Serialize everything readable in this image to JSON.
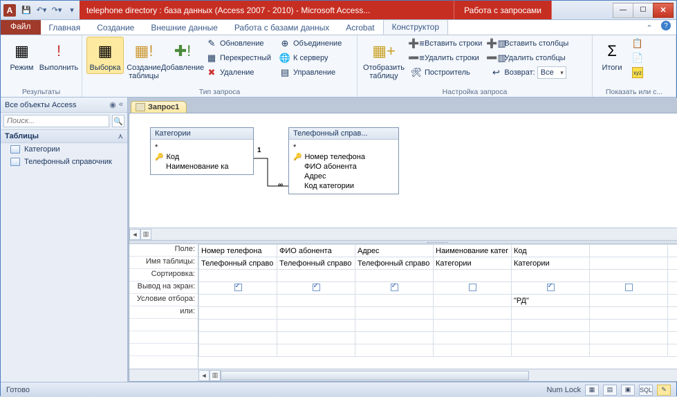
{
  "titlebar": {
    "app_letter": "A",
    "title": "telephone directory : база данных (Access 2007 - 2010)  -  Microsoft Access...",
    "context_tab": "Работа с запросами"
  },
  "tabs": {
    "file": "Файл",
    "items": [
      "Главная",
      "Создание",
      "Внешние данные",
      "Работа с базами данных",
      "Acrobat",
      "Конструктор"
    ],
    "active_index": 5
  },
  "ribbon": {
    "g1": {
      "label": "Результаты",
      "mode": "Режим",
      "run": "Выполнить"
    },
    "g2": {
      "label": "Тип запроса",
      "select": "Выборка",
      "maketable": "Создание\nтаблицы",
      "append": "Добавление",
      "update": "Обновление",
      "crosstab": "Перекрестный",
      "delete": "Удаление",
      "union": "Объединение",
      "passthrough": "К серверу",
      "datadef": "Управление"
    },
    "g3": {
      "label": "Настройка запроса",
      "showtable": "Отобразить\nтаблицу",
      "insrows": "Вставить строки",
      "delrows": "Удалить строки",
      "builder": "Построитель",
      "inscols": "Вставить столбцы",
      "delcols": "Удалить столбцы",
      "return": "Возврат:",
      "return_val": "Все"
    },
    "g4": {
      "label": "Показать или с...",
      "totals": "Итоги"
    }
  },
  "nav": {
    "header": "Все объекты Access",
    "search_placeholder": "Поиск...",
    "group": "Таблицы",
    "items": [
      "Категории",
      "Телефонный справочник"
    ]
  },
  "doc": {
    "tab": "Запрос1"
  },
  "diagram": {
    "t1": {
      "title": "Категории",
      "star": "*",
      "key": "Код",
      "f1": "Наименование ка"
    },
    "t2": {
      "title": "Телефонный справ...",
      "star": "*",
      "key": "Номер телефона",
      "f1": "ФИО абонента",
      "f2": "Адрес",
      "f3": "Код категории"
    },
    "card1": "1",
    "cardN": "∞"
  },
  "grid": {
    "labels": {
      "field": "Поле:",
      "table": "Имя таблицы:",
      "sort": "Сортировка:",
      "show": "Вывод на экран:",
      "criteria": "Условие отбора:",
      "or": "или:"
    },
    "cols": [
      {
        "field": "Номер телефона",
        "table": "Телефонный справо",
        "show": true,
        "criteria": ""
      },
      {
        "field": "ФИО абонента",
        "table": "Телефонный справо",
        "show": true,
        "criteria": ""
      },
      {
        "field": "Адрес",
        "table": "Телефонный справо",
        "show": true,
        "criteria": ""
      },
      {
        "field": "Наименование катег",
        "table": "Категории",
        "show": false,
        "criteria": ""
      },
      {
        "field": "Код",
        "table": "Категории",
        "show": true,
        "criteria": "\"РД\""
      }
    ]
  },
  "status": {
    "ready": "Готово",
    "numlock": "Num Lock",
    "sql": "SQL"
  }
}
